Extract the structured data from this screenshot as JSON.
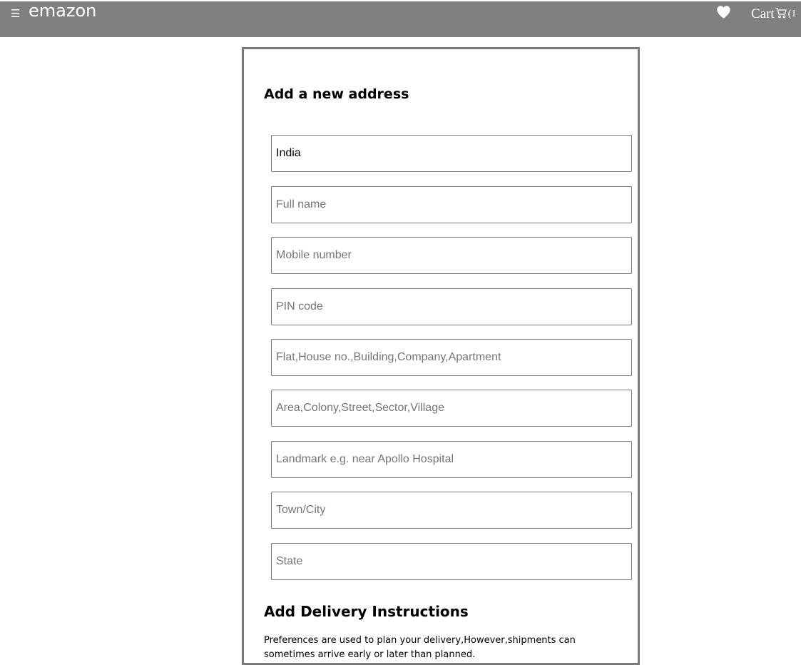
{
  "header": {
    "menu_icon": "☰",
    "logo": "emazon",
    "wishlist_icon": "heart-icon",
    "cart_label": "Cart",
    "cart_icon": "cart-icon",
    "cart_count": "(1"
  },
  "colors": {
    "header_bg": "#808080",
    "header_text": "#ffffff",
    "panel_border": "#7a7a7a",
    "placeholder": "#767676"
  },
  "address_form": {
    "title": "Add a new address",
    "country_value": "India",
    "full_name_placeholder": "Full name",
    "mobile_placeholder": "Mobile number",
    "pin_placeholder": "PIN code",
    "flat_placeholder": "Flat,House no.,Building,Company,Apartment",
    "area_placeholder": "Area,Colony,Street,Sector,Village",
    "landmark_placeholder": "Landmark e.g. near Apollo Hospital",
    "city_placeholder": "Town/City",
    "state_placeholder": "State"
  },
  "delivery": {
    "title": "Add Delivery Instructions",
    "text": "Preferences are used to plan your delivery,However,shipments can sometimes arrive early or later than planned."
  }
}
